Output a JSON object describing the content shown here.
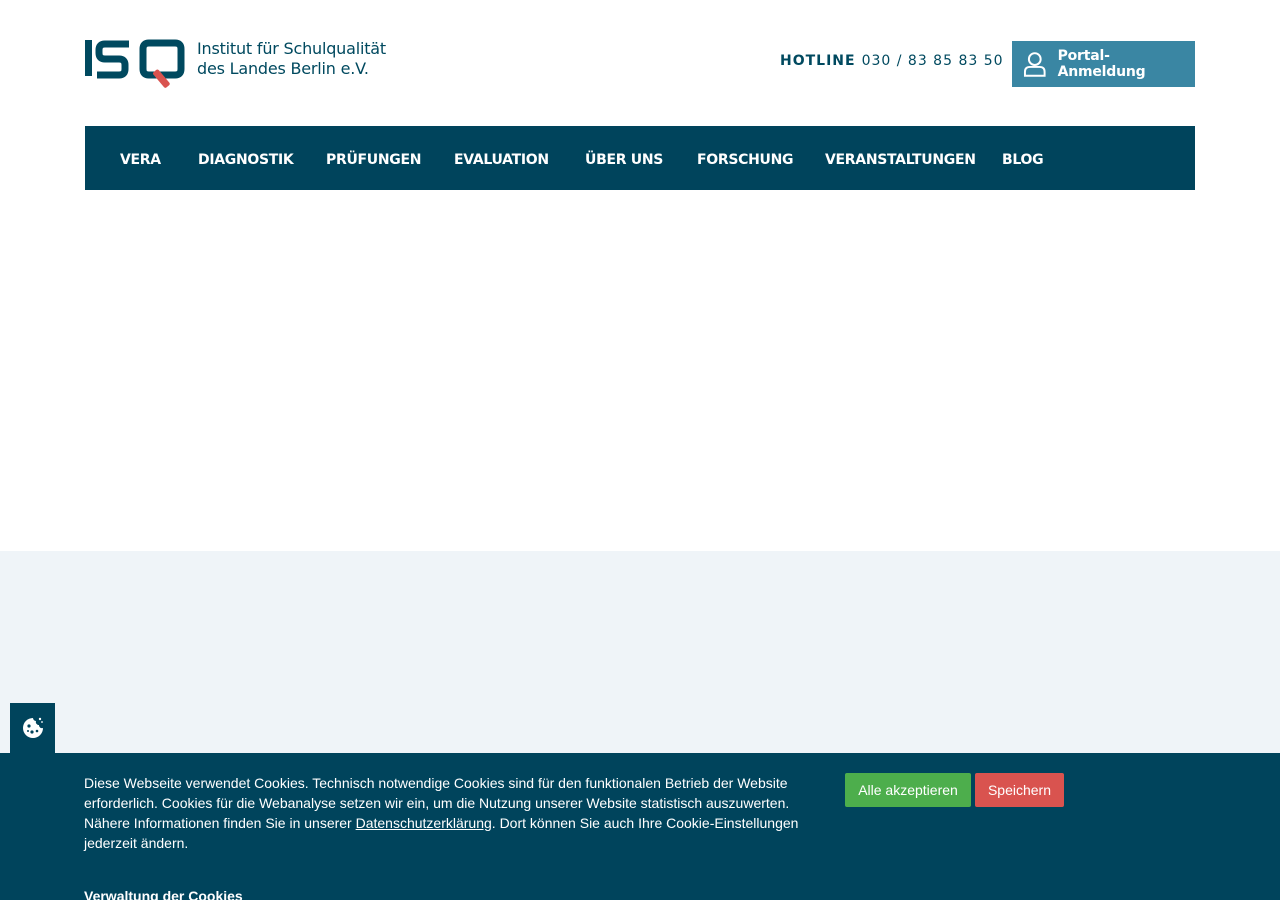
{
  "header": {
    "logo_text_line1": "Institut für Schulqualität",
    "logo_text_line2": "des Landes Berlin e.V.",
    "hotline_label": "HOTLINE",
    "hotline_number": "030 / 83 85 83 50",
    "portal_button_label": "Portal-Anmeldung"
  },
  "nav": {
    "items": [
      {
        "label": "VERA"
      },
      {
        "label": "DIAGNOSTIK"
      },
      {
        "label": "PRÜFUNGEN"
      },
      {
        "label": "EVALUATION"
      },
      {
        "label": "ÜBER UNS"
      },
      {
        "label": "FORSCHUNG"
      },
      {
        "label": "VERANSTALTUNGEN"
      },
      {
        "label": "BLOG"
      }
    ]
  },
  "cookie_banner": {
    "text_part1": "Diese Webseite verwendet Cookies. Technisch notwendige Cookies sind für den funktionalen Betrieb der Website erforderlich. Cookies für die Webanalyse setzen wir ein, um die Nutzung unserer Website statistisch auszuwerten. Nähere Informationen finden Sie in unserer ",
    "link_text": "Datenschutzerklärung",
    "text_part2": ". Dort können Sie auch Ihre Cookie-Einstellungen jederzeit ändern.",
    "accept_all_label": "Alle akzeptieren",
    "save_label": "Speichern",
    "manage_label": "Verwaltung der Cookies"
  },
  "colors": {
    "brand_dark": "#00445c",
    "brand_light": "#3a86a3",
    "logo_accent": "#d9534f",
    "accept_green": "#4dae4c",
    "save_red": "#d9534f",
    "section_bg": "#eff4f8"
  },
  "icons": {
    "portal_icon": "user-icon",
    "cookie_tab_icon": "cookie-icon"
  }
}
